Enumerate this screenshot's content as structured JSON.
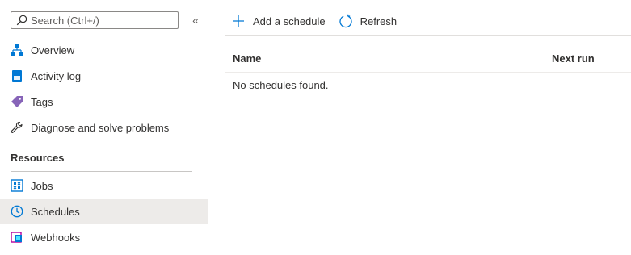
{
  "search": {
    "placeholder": "Search (Ctrl+/)",
    "value": ""
  },
  "sidebar": {
    "collapse_glyph": "«",
    "items": [
      {
        "label": "Overview",
        "icon": "overview-hierarchy-icon"
      },
      {
        "label": "Activity log",
        "icon": "activity-log-icon"
      },
      {
        "label": "Tags",
        "icon": "tag-icon"
      },
      {
        "label": "Diagnose and solve problems",
        "icon": "wrench-icon"
      }
    ],
    "section": "Resources",
    "resource_items": [
      {
        "label": "Jobs",
        "icon": "jobs-icon"
      },
      {
        "label": "Schedules",
        "icon": "clock-icon",
        "selected": true
      },
      {
        "label": "Webhooks",
        "icon": "webhook-icon"
      }
    ]
  },
  "toolbar": {
    "add_label": "Add a schedule",
    "refresh_label": "Refresh"
  },
  "grid": {
    "columns": [
      "Name",
      "Next run"
    ],
    "empty_message": "No schedules found."
  },
  "colors": {
    "accent": "#0078d4",
    "selected_bg": "#edebe9",
    "tag_purple": "#8764b8",
    "webhook_magenta": "#b4009e"
  }
}
